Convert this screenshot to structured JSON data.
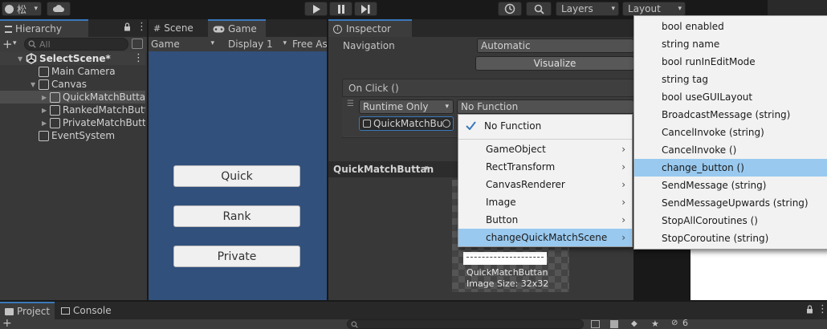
{
  "toolbar": {
    "account_label": "松",
    "layers_label": "Layers",
    "layout_label": "Layout"
  },
  "hierarchy": {
    "tab_label": "Hierarchy",
    "search_placeholder": "All",
    "scene_name": "SelectScene*",
    "items": [
      {
        "label": "Main Camera"
      },
      {
        "label": "Canvas"
      },
      {
        "label": "QuickMatchButtan"
      },
      {
        "label": "RankedMatchButtan"
      },
      {
        "label": "PrivateMatchButtan"
      },
      {
        "label": "EventSystem"
      }
    ]
  },
  "scene_tab": {
    "label": "Scene"
  },
  "game": {
    "tab_label": "Game",
    "mode_label": "Game",
    "display_label": "Display 1",
    "aspect_label": "Free As",
    "buttons": [
      {
        "label": "Quick"
      },
      {
        "label": "Rank"
      },
      {
        "label": "Private"
      }
    ]
  },
  "inspector": {
    "tab_label": "Inspector",
    "navigation_label": "Navigation",
    "navigation_value": "Automatic",
    "visualize_label": "Visualize",
    "onclick_label": "On Click ()",
    "runtime_value": "Runtime Only",
    "function_value": "No Function",
    "object_value": "QuickMatchBu",
    "preview_header": "QuickMatchButtan",
    "preview_name": "QuickMatchButtan",
    "preview_size": "Image Size: 32x32"
  },
  "component_menu": {
    "no_function_label": "No Function",
    "items": [
      {
        "label": "GameObject"
      },
      {
        "label": "RectTransform"
      },
      {
        "label": "CanvasRenderer"
      },
      {
        "label": "Image"
      },
      {
        "label": "Button"
      },
      {
        "label": "changeQuickMatchScene"
      }
    ]
  },
  "method_menu": {
    "items": [
      {
        "label": "bool enabled"
      },
      {
        "label": "string name"
      },
      {
        "label": "bool runInEditMode"
      },
      {
        "label": "string tag"
      },
      {
        "label": "bool useGUILayout"
      },
      {
        "label": "BroadcastMessage (string)"
      },
      {
        "label": "CancelInvoke (string)"
      },
      {
        "label": "CancelInvoke ()"
      },
      {
        "label": "change_button ()"
      },
      {
        "label": "SendMessage (string)"
      },
      {
        "label": "SendMessageUpwards (string)"
      },
      {
        "label": "StopAllCoroutines ()"
      },
      {
        "label": "StopCoroutine (string)"
      }
    ]
  },
  "bottom": {
    "project_tab": "Project",
    "console_tab": "Console",
    "hidden_count": "6"
  },
  "colors": {
    "game_bg": "#31507c",
    "highlight": "#99c9ef",
    "accent": "#3a79bb"
  }
}
